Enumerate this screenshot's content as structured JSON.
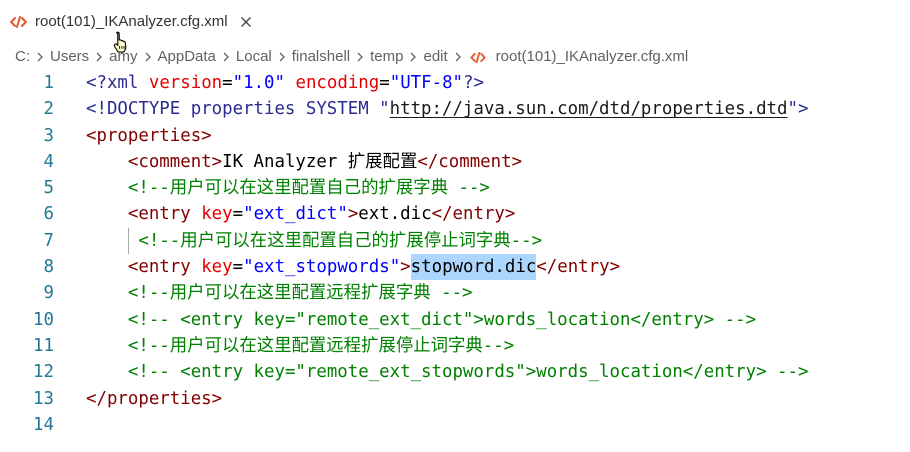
{
  "theme": {
    "tag": "#800000",
    "attribute": "#e50000",
    "string": "#0000ff",
    "comment": "#008000",
    "declaration": "#2b2b8f",
    "line_number": "#237893",
    "selection": "#add6ff",
    "xml_icon": "#e4572e"
  },
  "tab": {
    "icon": "xml-file-icon",
    "title": "root(101)_IKAnalyzer.cfg.xml",
    "close_icon": "close-icon"
  },
  "pointer": {
    "icon": "hand-pointer-icon"
  },
  "breadcrumb": {
    "separator_icon": "chevron-right-icon",
    "items": [
      "C:",
      "Users",
      "amy",
      "AppData",
      "Local",
      "finalshell",
      "temp",
      "edit"
    ],
    "file_icon": "xml-file-icon",
    "file": "root(101)_IKAnalyzer.cfg.xml"
  },
  "editor": {
    "lines": [
      {
        "number": "1",
        "tokens": [
          {
            "type": "decl",
            "text": "<?xml"
          },
          {
            "type": "text",
            "text": " "
          },
          {
            "type": "attr",
            "text": "version"
          },
          {
            "type": "punct",
            "text": "="
          },
          {
            "type": "string",
            "text": "\"1.0\""
          },
          {
            "type": "text",
            "text": " "
          },
          {
            "type": "attr",
            "text": "encoding"
          },
          {
            "type": "punct",
            "text": "="
          },
          {
            "type": "string",
            "text": "\"UTF-8\""
          },
          {
            "type": "decl",
            "text": "?>"
          }
        ]
      },
      {
        "number": "2",
        "tokens": [
          {
            "type": "decl",
            "text": "<!DOCTYPE properties SYSTEM \""
          },
          {
            "type": "link",
            "text": "http://java.sun.com/dtd/properties.dtd"
          },
          {
            "type": "decl",
            "text": "\">"
          }
        ]
      },
      {
        "number": "3",
        "tokens": [
          {
            "type": "tag",
            "text": "<properties>"
          }
        ]
      },
      {
        "number": "4",
        "tokens": [
          {
            "type": "indent",
            "text": "    "
          },
          {
            "type": "tag",
            "text": "<comment>"
          },
          {
            "type": "text",
            "text": "IK Analyzer 扩展配置"
          },
          {
            "type": "tag",
            "text": "</comment>"
          }
        ]
      },
      {
        "number": "5",
        "tokens": [
          {
            "type": "indent",
            "text": "    "
          },
          {
            "type": "comment",
            "text": "<!--用户可以在这里配置自己的扩展字典 -->"
          }
        ]
      },
      {
        "number": "6",
        "tokens": [
          {
            "type": "indent",
            "text": "    "
          },
          {
            "type": "tag",
            "text": "<entry"
          },
          {
            "type": "text",
            "text": " "
          },
          {
            "type": "attr",
            "text": "key"
          },
          {
            "type": "punct",
            "text": "="
          },
          {
            "type": "string",
            "text": "\"ext_dict\""
          },
          {
            "type": "tag",
            "text": ">"
          },
          {
            "type": "text",
            "text": "ext.dic"
          },
          {
            "type": "tag",
            "text": "</entry>"
          }
        ]
      },
      {
        "number": "7",
        "tokens": [
          {
            "type": "indent",
            "text": "     ",
            "guide": true
          },
          {
            "type": "comment",
            "text": "<!--用户可以在这里配置自己的扩展停止词字典-->"
          }
        ]
      },
      {
        "number": "8",
        "tokens": [
          {
            "type": "indent",
            "text": "    "
          },
          {
            "type": "tag",
            "text": "<entry"
          },
          {
            "type": "text",
            "text": " "
          },
          {
            "type": "attr",
            "text": "key"
          },
          {
            "type": "punct",
            "text": "="
          },
          {
            "type": "string",
            "text": "\"ext_stopwords\""
          },
          {
            "type": "tag",
            "text": ">"
          },
          {
            "type": "text",
            "text": "stopword.dic",
            "selected": true
          },
          {
            "type": "tag",
            "text": "</entry>"
          }
        ]
      },
      {
        "number": "9",
        "tokens": [
          {
            "type": "indent",
            "text": "    "
          },
          {
            "type": "comment",
            "text": "<!--用户可以在这里配置远程扩展字典 -->"
          }
        ]
      },
      {
        "number": "10",
        "tokens": [
          {
            "type": "indent",
            "text": "    "
          },
          {
            "type": "comment",
            "text": "<!-- <entry key=\"remote_ext_dict\">words_location</entry> -->"
          }
        ]
      },
      {
        "number": "11",
        "tokens": [
          {
            "type": "indent",
            "text": "    "
          },
          {
            "type": "comment",
            "text": "<!--用户可以在这里配置远程扩展停止词字典-->"
          }
        ]
      },
      {
        "number": "12",
        "tokens": [
          {
            "type": "indent",
            "text": "    "
          },
          {
            "type": "comment",
            "text": "<!-- <entry key=\"remote_ext_stopwords\">words_location</entry> -->"
          }
        ]
      },
      {
        "number": "13",
        "tokens": [
          {
            "type": "tag",
            "text": "</properties>"
          }
        ]
      },
      {
        "number": "14",
        "tokens": []
      }
    ]
  }
}
